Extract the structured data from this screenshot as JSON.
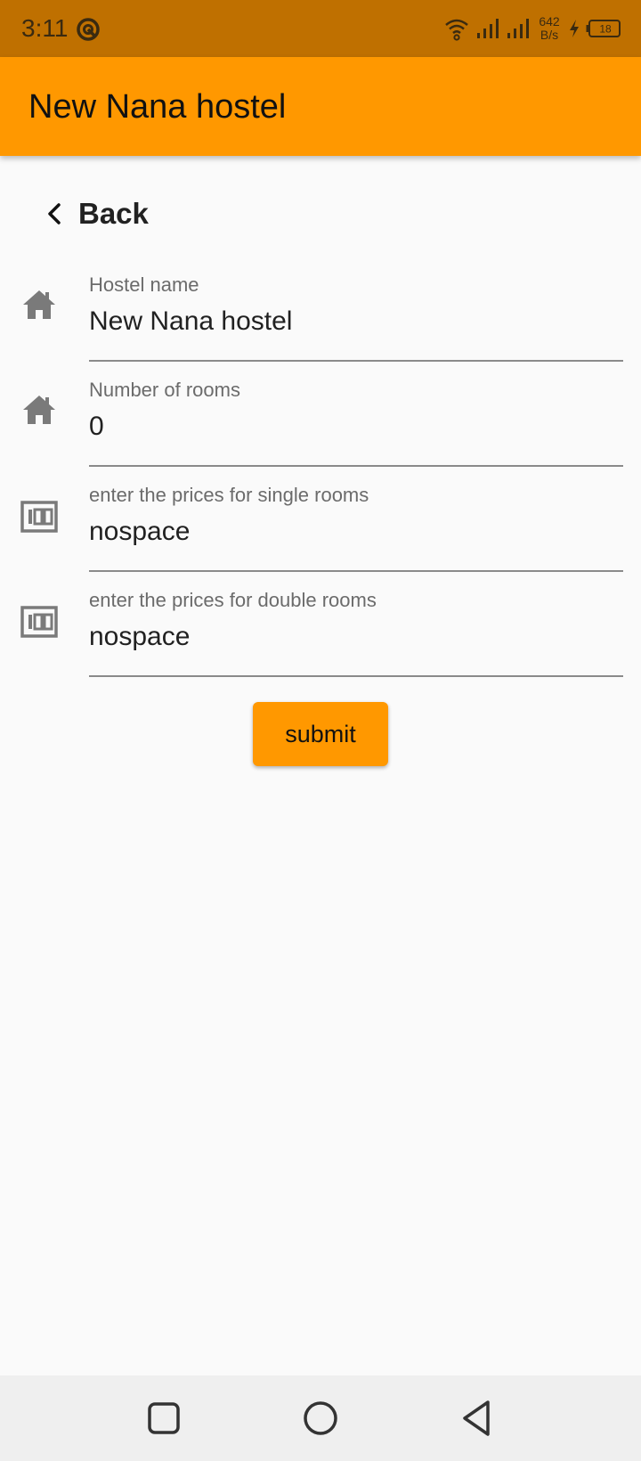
{
  "status_bar": {
    "time": "3:11",
    "net_speed_value": "642",
    "net_speed_unit": "B/s",
    "battery_level": "18",
    "icons": [
      "dnd-icon",
      "wifi-icon",
      "signal-icon",
      "signal-icon",
      "charging-icon",
      "battery-icon"
    ]
  },
  "app_bar": {
    "title": "New Nana hostel",
    "background": "#ff9800"
  },
  "back": {
    "label": "Back"
  },
  "form": {
    "fields": [
      {
        "icon": "house-icon",
        "label": "Hostel name",
        "value": "New Nana hostel"
      },
      {
        "icon": "house-icon",
        "label": "Number of rooms",
        "value": "0"
      },
      {
        "icon": "money-icon",
        "label": "enter the prices for single rooms",
        "value": "nospace"
      },
      {
        "icon": "money-icon",
        "label": "enter the prices for double rooms",
        "value": "nospace"
      }
    ],
    "submit_label": "submit"
  },
  "nav_bar": {
    "buttons": [
      "recents-icon",
      "home-icon",
      "back-icon"
    ]
  }
}
